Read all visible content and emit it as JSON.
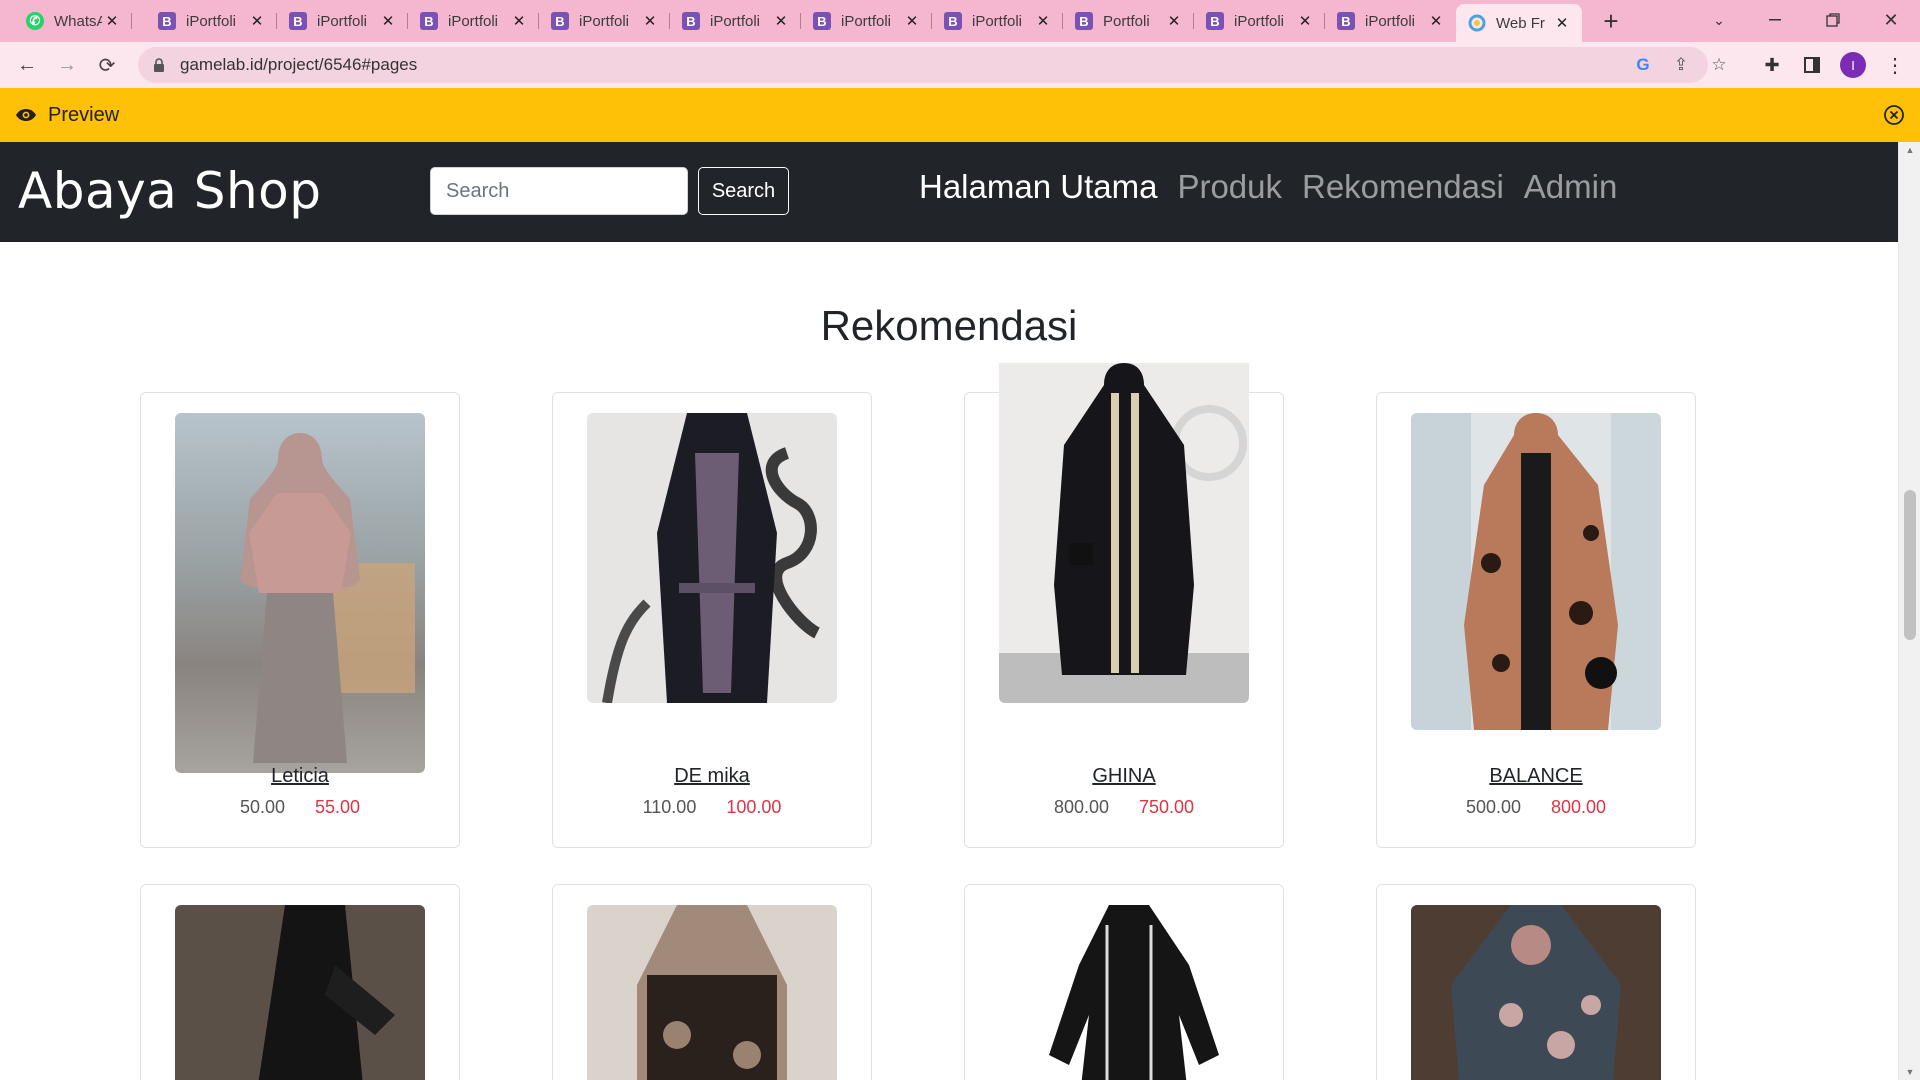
{
  "browser": {
    "tabs": [
      {
        "title": "WhatsA",
        "favicon": "whatsapp-icon",
        "color": "#25d366"
      },
      {
        "title": "iPortfoli",
        "favicon": "bootstrap-icon",
        "color": "#7952b3"
      },
      {
        "title": "iPortfoli",
        "favicon": "bootstrap-icon",
        "color": "#7952b3"
      },
      {
        "title": "iPortfoli",
        "favicon": "bootstrap-icon",
        "color": "#7952b3"
      },
      {
        "title": "iPortfoli",
        "favicon": "bootstrap-icon",
        "color": "#7952b3"
      },
      {
        "title": "iPortfoli",
        "favicon": "bootstrap-icon",
        "color": "#7952b3"
      },
      {
        "title": "iPortfoli",
        "favicon": "bootstrap-icon",
        "color": "#7952b3"
      },
      {
        "title": "iPortfoli",
        "favicon": "bootstrap-icon",
        "color": "#7952b3"
      },
      {
        "title": "Portfoli",
        "favicon": "bootstrap-icon",
        "color": "#7952b3"
      },
      {
        "title": "iPortfoli",
        "favicon": "bootstrap-icon",
        "color": "#7952b3"
      },
      {
        "title": "iPortfoli",
        "favicon": "bootstrap-icon",
        "color": "#7952b3"
      },
      {
        "title": "Web Fr",
        "favicon": "gamelab-icon",
        "color": "#4aa3df",
        "active": true
      }
    ],
    "url": "gamelab.id/project/6546#pages",
    "profile_initial": "I"
  },
  "preview_bar": {
    "label": "Preview",
    "color": "#ffc107"
  },
  "navbar": {
    "brand": "Abaya Shop",
    "search_placeholder": "Search",
    "search_button": "Search",
    "menu": [
      "Halaman Utama",
      "Produk",
      "Rekomendasi",
      "Admin"
    ],
    "active_menu": "Halaman Utama"
  },
  "section": {
    "title": "Rekomendasi"
  },
  "products": [
    {
      "name": "Leticia",
      "price_old": "50.00",
      "price_new": "55.00"
    },
    {
      "name": "DE mika",
      "price_old": "110.00",
      "price_new": "100.00"
    },
    {
      "name": "GHINA",
      "price_old": "800.00",
      "price_new": "750.00"
    },
    {
      "name": "BALANCE",
      "price_old": "500.00",
      "price_new": "800.00"
    }
  ],
  "colors": {
    "navbar": "#212529",
    "sale_price": "#dc3545",
    "tabstrip": "#f5b6cf"
  }
}
